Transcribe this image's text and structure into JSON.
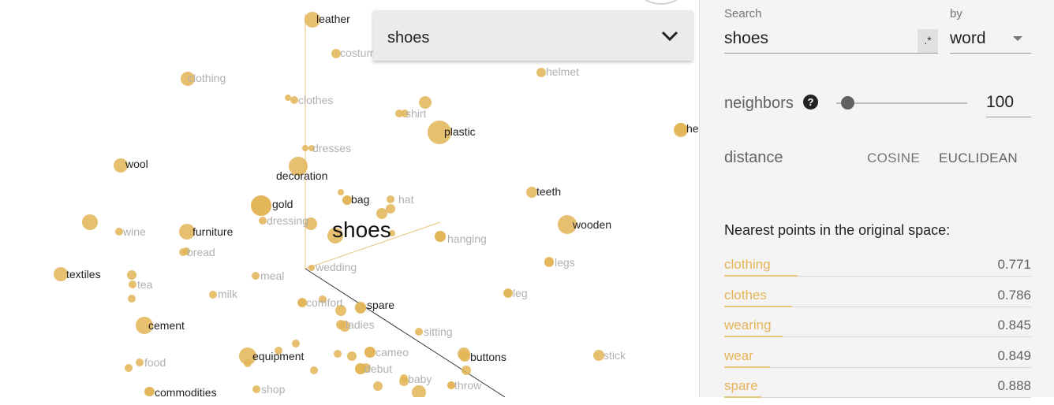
{
  "scatter": {
    "accent": "#e2b456",
    "focus_label": "shoes",
    "points": [
      {
        "label": "leather",
        "dim": false
      },
      {
        "label": "costume",
        "dim": true
      },
      {
        "label": "helmet",
        "dim": true
      },
      {
        "label": "clothing",
        "dim": true
      },
      {
        "label": "clothes",
        "dim": true
      },
      {
        "label": "shirt",
        "dim": true
      },
      {
        "label": "plastic",
        "dim": false
      },
      {
        "label": "he",
        "dim": false
      },
      {
        "label": "dresses",
        "dim": true
      },
      {
        "label": "wool",
        "dim": false
      },
      {
        "label": "decoration",
        "dim": false
      },
      {
        "label": "teeth",
        "dim": false
      },
      {
        "label": "gold",
        "dim": false
      },
      {
        "label": "bag",
        "dim": false
      },
      {
        "label": "hat",
        "dim": true
      },
      {
        "label": "dressing",
        "dim": true
      },
      {
        "label": "wine",
        "dim": true
      },
      {
        "label": "furniture",
        "dim": false
      },
      {
        "label": "wooden",
        "dim": false
      },
      {
        "label": "hanging",
        "dim": true
      },
      {
        "label": "bread",
        "dim": true
      },
      {
        "label": "legs",
        "dim": true
      },
      {
        "label": "textiles",
        "dim": false
      },
      {
        "label": "wedding",
        "dim": true
      },
      {
        "label": "meal",
        "dim": true
      },
      {
        "label": "tea",
        "dim": true
      },
      {
        "label": "milk",
        "dim": true
      },
      {
        "label": "leg",
        "dim": true
      },
      {
        "label": "comfort",
        "dim": true
      },
      {
        "label": "spare",
        "dim": false
      },
      {
        "label": "cement",
        "dim": false
      },
      {
        "label": "ladies",
        "dim": true
      },
      {
        "label": "sitting",
        "dim": true
      },
      {
        "label": "equipment",
        "dim": false
      },
      {
        "label": "cameo",
        "dim": true
      },
      {
        "label": "buttons",
        "dim": false
      },
      {
        "label": "stick",
        "dim": true
      },
      {
        "label": "food",
        "dim": true
      },
      {
        "label": "debut",
        "dim": true
      },
      {
        "label": "baby",
        "dim": true
      },
      {
        "label": "commodities",
        "dim": false
      },
      {
        "label": "shop",
        "dim": true
      },
      {
        "label": "throw",
        "dim": true
      }
    ]
  },
  "dropdown": {
    "value": "shoes",
    "icon": "chevron-down-icon"
  },
  "panel": {
    "search_label": "Search",
    "search_value": "shoes",
    "regex_label": ".*",
    "by_label": "by",
    "by_value": "word",
    "neighbors_label": "neighbors",
    "help_icon_text": "?",
    "neighbors_value": "100",
    "neighbors_slider_fraction": 0.04,
    "distance_label": "distance",
    "cosine_label": "COSINE",
    "euclidean_label": "EUCLIDEAN",
    "nearest_title": "Nearest points in the original space:",
    "neighbors": [
      {
        "word": "clothing",
        "distance": "0.771",
        "bar": 0.24
      },
      {
        "word": "clothes",
        "distance": "0.786",
        "bar": 0.22
      },
      {
        "word": "wearing",
        "distance": "0.845",
        "bar": 0.19
      },
      {
        "word": "wear",
        "distance": "0.849",
        "bar": 0.15
      },
      {
        "word": "spare",
        "distance": "0.888",
        "bar": 0.12
      }
    ]
  }
}
